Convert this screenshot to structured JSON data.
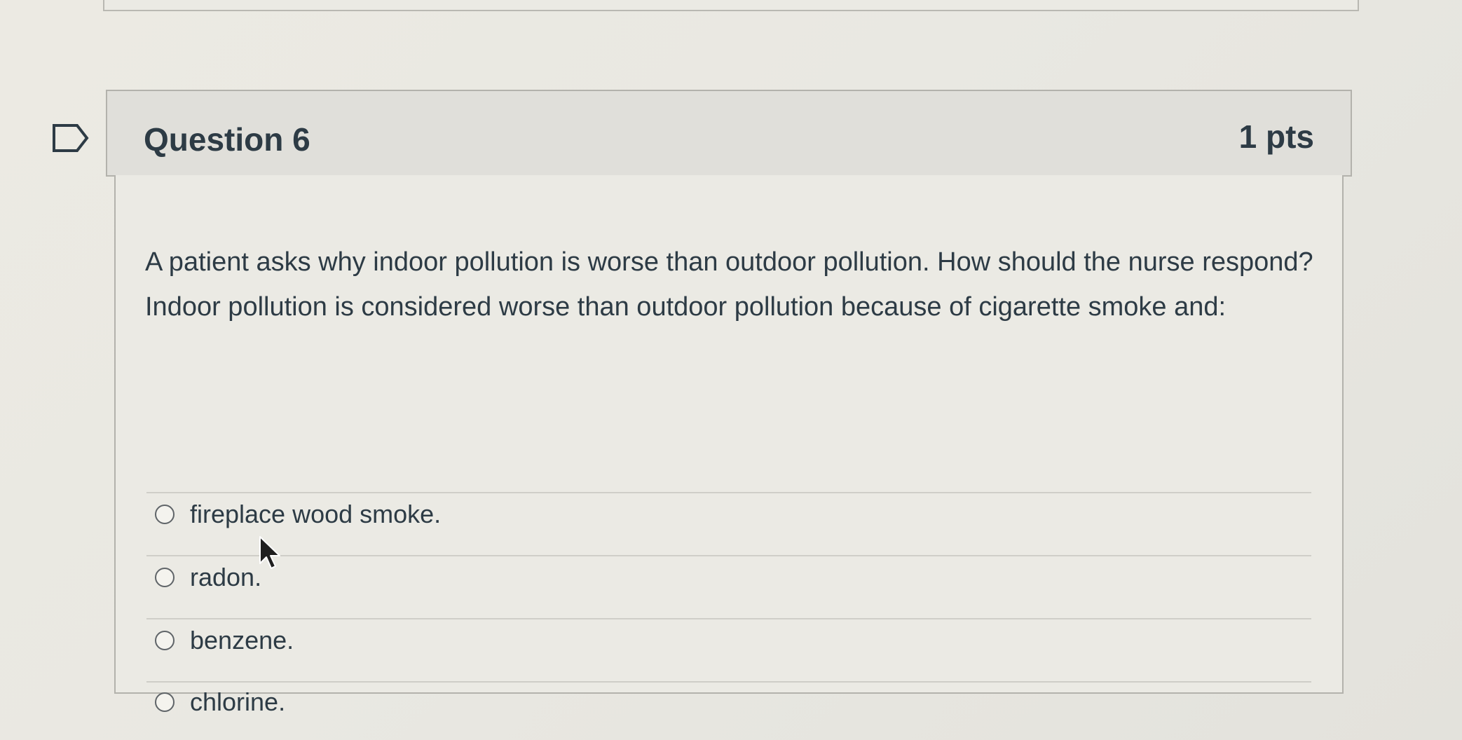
{
  "question": {
    "title": "Question 6",
    "points": "1 pts",
    "text": "A patient asks why indoor pollution is worse than outdoor pollution. How should the nurse respond? Indoor pollution is considered worse than outdoor pollution because of cigarette smoke and:",
    "answers": [
      {
        "label": "fireplace wood smoke.",
        "selected": false
      },
      {
        "label": "radon.",
        "selected": false
      },
      {
        "label": "benzene.",
        "selected": false
      },
      {
        "label": "chlorine.",
        "selected": false
      }
    ]
  },
  "icons": {
    "flag": "flag-question-icon",
    "cursor": "mouse-pointer-icon",
    "radio": "radio-button-icon"
  },
  "colors": {
    "text": "#2d3b45",
    "header_background": "#e0dfda",
    "body_background": "#ebeae4",
    "border": "#b3b2ac"
  }
}
